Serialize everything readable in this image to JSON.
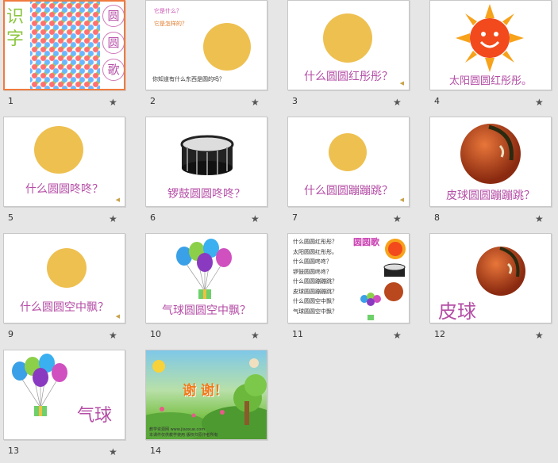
{
  "slides": [
    {
      "number": "1",
      "title_chars": [
        "识",
        "字"
      ],
      "circle_chars": [
        "圆",
        "圆",
        "歌"
      ]
    },
    {
      "number": "2",
      "q1": "它是什么？",
      "q2": "它是怎样的？",
      "bottom": "你知道有什么东西是圆的吗？"
    },
    {
      "number": "3",
      "caption": "什么圆圆红彤彤？"
    },
    {
      "number": "4",
      "caption": "太阳圆圆红彤彤。"
    },
    {
      "number": "5",
      "caption": "什么圆圆咚咚？"
    },
    {
      "number": "6",
      "caption": "锣鼓圆圆咚咚？"
    },
    {
      "number": "7",
      "caption": "什么圆圆蹦蹦跳？"
    },
    {
      "number": "8",
      "caption": "皮球圆圆蹦蹦跳？"
    },
    {
      "number": "9",
      "caption": "什么圆圆空中飘？"
    },
    {
      "number": "10",
      "caption": "气球圆圆空中飘？"
    },
    {
      "number": "11",
      "title": "圆圆歌",
      "lines": [
        "什么圆圆红彤彤？",
        "太阳圆圆红彤彤。",
        "什么圆圆咚咚？",
        "锣鼓圆圆咚咚？",
        "什么圆圆蹦蹦跳？",
        "皮球圆圆蹦蹦跳？",
        "什么圆圆空中飘？",
        "气球圆圆空中飘？"
      ]
    },
    {
      "number": "12",
      "word": "皮球"
    },
    {
      "number": "13",
      "word": "气球"
    },
    {
      "number": "14",
      "thanks": "谢 谢！",
      "footer1": "教学资源网 www.jiaoxue.com",
      "footer2": "本课件仅供教学使用 版权归原作者所有"
    }
  ],
  "slide_icon": "star-icon",
  "colors": {
    "accent": "#f07b3f",
    "caption": "#b54da6",
    "sun_yellow": "#eec050",
    "selection": "#f07b3f"
  }
}
